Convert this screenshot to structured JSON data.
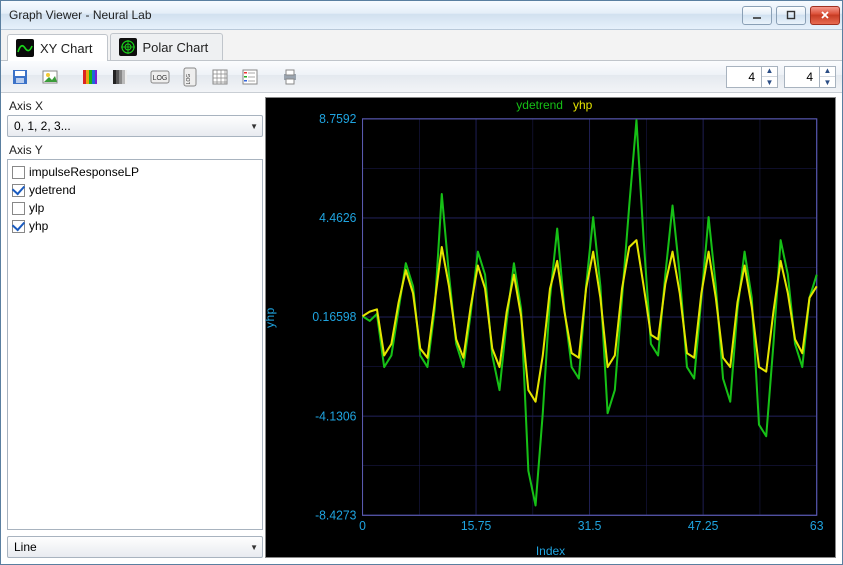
{
  "window_title": "Graph Viewer - Neural Lab",
  "tabs": [
    {
      "label": "XY Chart",
      "active": true
    },
    {
      "label": "Polar Chart",
      "active": false
    }
  ],
  "toolbar": {
    "spin1": "4",
    "spin2": "4"
  },
  "axis_x": {
    "label": "Axis X",
    "combo_value": "0, 1, 2, 3..."
  },
  "axis_y": {
    "label": "Axis Y",
    "items": [
      {
        "label": "impulseResponseLP",
        "checked": false
      },
      {
        "label": "ydetrend",
        "checked": true
      },
      {
        "label": "ylp",
        "checked": false
      },
      {
        "label": "yhp",
        "checked": true
      }
    ]
  },
  "chart_type_combo": "Line",
  "chart_data": {
    "type": "line",
    "title": "",
    "xlabel": "Index",
    "ylabel": "yhp",
    "x_ticks": [
      "0",
      "15.75",
      "31.5",
      "47.25",
      "63"
    ],
    "y_ticks": [
      "-8.4273",
      "-4.1306",
      "0.16598",
      "4.4626",
      "8.7592"
    ],
    "xlim": [
      0,
      63
    ],
    "ylim": [
      -8.4273,
      8.7592
    ],
    "legend": [
      "ydetrend",
      "yhp"
    ],
    "series": [
      {
        "name": "ydetrend",
        "color": "#16c016",
        "x": [
          0,
          1,
          2,
          3,
          4,
          5,
          6,
          7,
          8,
          9,
          10,
          11,
          12,
          13,
          14,
          15,
          16,
          17,
          18,
          19,
          20,
          21,
          22,
          23,
          24,
          25,
          26,
          27,
          28,
          29,
          30,
          31,
          32,
          33,
          34,
          35,
          36,
          37,
          38,
          39,
          40,
          41,
          42,
          43,
          44,
          45,
          46,
          47,
          48,
          49,
          50,
          51,
          52,
          53,
          54,
          55,
          56,
          57,
          58,
          59,
          60,
          61,
          62,
          63
        ],
        "values": [
          0.2,
          0.0,
          0.3,
          -2.0,
          -1.5,
          0.5,
          2.5,
          1.5,
          -1.5,
          -2.0,
          0.5,
          5.5,
          2.0,
          -1.0,
          -2.0,
          0.3,
          3.0,
          2.0,
          -1.5,
          -3.0,
          0.0,
          2.5,
          0.5,
          -6.5,
          -8.0,
          -4.0,
          1.0,
          4.0,
          0.5,
          -2.0,
          -2.5,
          1.5,
          4.5,
          1.5,
          -4.0,
          -3.0,
          1.0,
          5.0,
          8.7,
          3.5,
          -1.0,
          -1.5,
          2.0,
          5.0,
          2.0,
          -2.0,
          -2.5,
          1.0,
          4.5,
          1.5,
          -2.5,
          -3.5,
          0.5,
          3.0,
          1.0,
          -4.5,
          -5.0,
          -1.0,
          3.5,
          2.0,
          -1.0,
          -2.0,
          1.0,
          2.0
        ]
      },
      {
        "name": "yhp",
        "color": "#e5e500",
        "x": [
          0,
          1,
          2,
          3,
          4,
          5,
          6,
          7,
          8,
          9,
          10,
          11,
          12,
          13,
          14,
          15,
          16,
          17,
          18,
          19,
          20,
          21,
          22,
          23,
          24,
          25,
          26,
          27,
          28,
          29,
          30,
          31,
          32,
          33,
          34,
          35,
          36,
          37,
          38,
          39,
          40,
          41,
          42,
          43,
          44,
          45,
          46,
          47,
          48,
          49,
          50,
          51,
          52,
          53,
          54,
          55,
          56,
          57,
          58,
          59,
          60,
          61,
          62,
          63
        ],
        "values": [
          0.2,
          0.4,
          0.5,
          -1.5,
          -1.0,
          0.8,
          2.2,
          1.2,
          -1.2,
          -1.6,
          0.8,
          3.2,
          1.5,
          -0.8,
          -1.6,
          0.6,
          2.4,
          1.4,
          -1.2,
          -2.0,
          0.4,
          2.0,
          0.2,
          -3.0,
          -3.5,
          -1.5,
          1.4,
          2.6,
          0.4,
          -1.4,
          -1.6,
          1.4,
          3.0,
          1.0,
          -2.0,
          -1.5,
          1.4,
          3.2,
          3.5,
          1.5,
          -0.6,
          -0.8,
          1.6,
          3.0,
          1.2,
          -1.4,
          -1.6,
          1.2,
          3.0,
          1.0,
          -1.6,
          -2.0,
          0.8,
          2.4,
          0.6,
          -2.0,
          -2.2,
          0.4,
          2.6,
          1.2,
          -0.8,
          -1.4,
          1.0,
          1.5
        ]
      }
    ]
  }
}
